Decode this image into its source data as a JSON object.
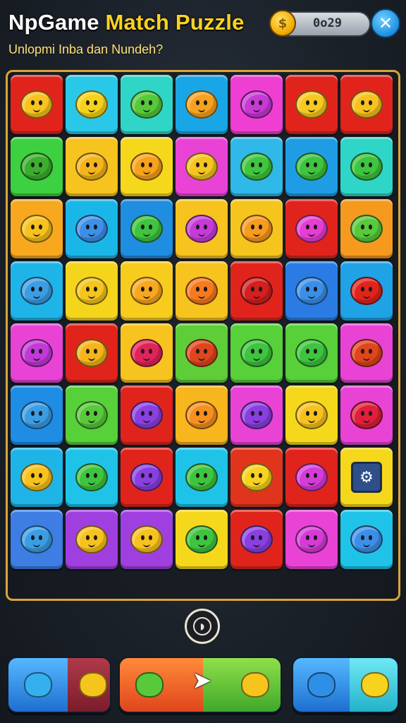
{
  "header": {
    "title_prefix": "NpGame ",
    "title_accent": "Match Puzzle",
    "subtitle": "Unlopmi Inba dan Nundeh?",
    "timer": "0o29",
    "coin_icon": "coin-icon",
    "close_icon": "close-icon"
  },
  "board": {
    "rows": [
      [
        [
          "#e0241c",
          "#f9c21e"
        ],
        [
          "#29c8e8",
          "#f7d21a"
        ],
        [
          "#2fd6c7",
          "#56c93a"
        ],
        [
          "#19a6e6",
          "#f7a21e"
        ],
        [
          "#ee3fd2",
          "#c939d6"
        ],
        [
          "#e0241c",
          "#f7c820"
        ],
        [
          "#e0241c",
          "#f7c21e"
        ]
      ],
      [
        [
          "#3dd040",
          "#3cae2e"
        ],
        [
          "#f7c31e",
          "#f5b51a"
        ],
        [
          "#f5d81c",
          "#f7a21a"
        ],
        [
          "#e943d6",
          "#f5c51e"
        ],
        [
          "#2fb8e8",
          "#3fc63e"
        ],
        [
          "#1f9de4",
          "#3ec43e"
        ],
        [
          "#2fd6c7",
          "#3ec43e"
        ]
      ],
      [
        [
          "#f7a81e",
          "#f7c21e"
        ],
        [
          "#1ab6e8",
          "#3d8fe8"
        ],
        [
          "#1f8de0",
          "#3ec43e"
        ],
        [
          "#f7c31e",
          "#c63bd8"
        ],
        [
          "#f5c51e",
          "#f79a1e"
        ],
        [
          "#e0241c",
          "#e63dd2"
        ],
        [
          "#f59a1e",
          "#57c93a"
        ]
      ],
      [
        [
          "#1fb4e8",
          "#3b9de4"
        ],
        [
          "#f5d51c",
          "#f5c51e"
        ],
        [
          "#f7cc1e",
          "#f7a81e"
        ],
        [
          "#f7c31e",
          "#f77a1e"
        ],
        [
          "#e0241c",
          "#d41f1f"
        ],
        [
          "#2a7ce4",
          "#3b8fe8"
        ],
        [
          "#1fa2e6",
          "#e0241c"
        ]
      ],
      [
        [
          "#e943d6",
          "#c239d8"
        ],
        [
          "#e0241c",
          "#f5b51a"
        ],
        [
          "#f7c31e",
          "#e0245a"
        ],
        [
          "#5fcd38",
          "#e0451c"
        ],
        [
          "#57d03a",
          "#3ec43e"
        ],
        [
          "#57d03a",
          "#3ec43e"
        ],
        [
          "#e943d6",
          "#e0451c"
        ]
      ],
      [
        [
          "#1f8de4",
          "#3b9de4"
        ],
        [
          "#57d03a",
          "#57c93a"
        ],
        [
          "#e0241c",
          "#8a3fe0"
        ],
        [
          "#f7b51e",
          "#f7901e"
        ],
        [
          "#e943d6",
          "#8a3fe0"
        ],
        [
          "#f5d81c",
          "#f7c21e"
        ],
        [
          "#e943d6",
          "#e01f3a"
        ]
      ],
      [
        [
          "#1fb4e8",
          "#f7c21e"
        ],
        [
          "#1fc3e8",
          "#3ec43e"
        ],
        [
          "#e0241c",
          "#8a3fe0"
        ],
        [
          "#1fc3e8",
          "#3ec43e"
        ],
        [
          "#e0351c",
          "#f7d21e"
        ],
        [
          "#e0241c",
          "#d63bd8"
        ],
        [
          "#f5d81c",
          "special"
        ]
      ],
      [
        [
          "#3d7de4",
          "#3b9de4"
        ],
        [
          "#a03fe0",
          "#f7c21e"
        ],
        [
          "#a03fe0",
          "#f7c21e"
        ],
        [
          "#f5d81c",
          "#3ec43e"
        ],
        [
          "#e0241c",
          "#8a3fe0"
        ],
        [
          "#e943d6",
          "#d63bd8"
        ],
        [
          "#1fc3e8",
          "#3b8fe8"
        ]
      ]
    ],
    "special_icon": "gear-icon"
  },
  "controls": {
    "pause_icon": "pause-icon",
    "cursor_icon": "cursor-arrow-icon"
  },
  "colors": {
    "board_border": "#d9a53a",
    "title_accent": "#ffd21f",
    "subtitle": "#ffe27a"
  }
}
